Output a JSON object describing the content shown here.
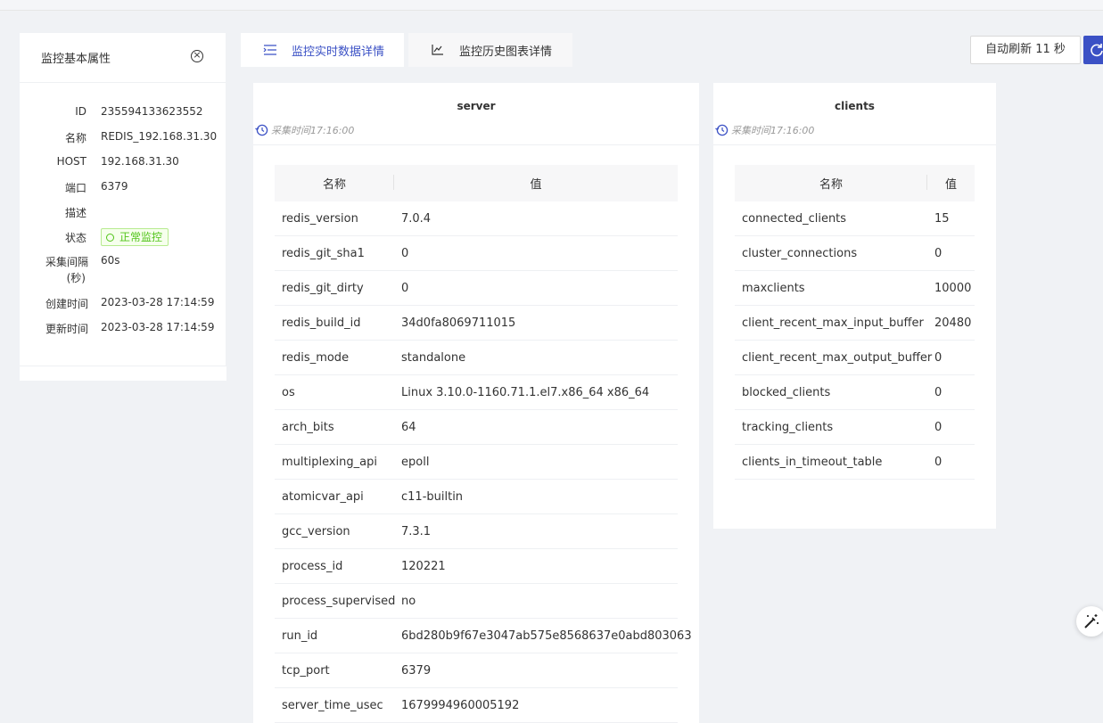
{
  "left_panel": {
    "title": "监控基本属性",
    "props": [
      {
        "label": "ID",
        "value": "235594133623552"
      },
      {
        "label": "名称",
        "value": "REDIS_192.168.31.30"
      },
      {
        "label": "HOST",
        "value": "192.168.31.30"
      },
      {
        "label": "端口",
        "value": "6379"
      },
      {
        "label": "描述",
        "value": ""
      },
      {
        "label": "状态",
        "value": "正常监控"
      },
      {
        "label": "采集间隔",
        "label2": "(秒)",
        "value": "60s"
      },
      {
        "label": "创建时间",
        "value": "2023-03-28 17:14:59"
      },
      {
        "label": "更新时间",
        "value": "2023-03-28 17:14:59"
      }
    ]
  },
  "tabs": {
    "realtime": "监控实时数据详情",
    "history": "监控历史图表详情"
  },
  "refresh": {
    "label": "自动刷新 11 秒"
  },
  "server": {
    "title": "server",
    "time": "采集时间17:16:00",
    "col_name": "名称",
    "col_value": "值",
    "rows": [
      [
        "redis_version",
        "7.0.4"
      ],
      [
        "redis_git_sha1",
        "0"
      ],
      [
        "redis_git_dirty",
        "0"
      ],
      [
        "redis_build_id",
        "34d0fa8069711015"
      ],
      [
        "redis_mode",
        "standalone"
      ],
      [
        "os",
        "Linux 3.10.0-1160.71.1.el7.x86_64 x86_64"
      ],
      [
        "arch_bits",
        "64"
      ],
      [
        "multiplexing_api",
        "epoll"
      ],
      [
        "atomicvar_api",
        "c11-builtin"
      ],
      [
        "gcc_version",
        "7.3.1"
      ],
      [
        "process_id",
        "120221"
      ],
      [
        "process_supervised",
        "no"
      ],
      [
        "run_id",
        "6bd280b9f67e3047ab575e8568637e0abd803063"
      ],
      [
        "tcp_port",
        "6379"
      ],
      [
        "server_time_usec",
        "1679994960005192"
      ]
    ]
  },
  "clients": {
    "title": "clients",
    "time": "采集时间17:16:00",
    "col_name": "名称",
    "col_value": "值",
    "rows": [
      [
        "connected_clients",
        "15"
      ],
      [
        "cluster_connections",
        "0"
      ],
      [
        "maxclients",
        "10000"
      ],
      [
        "client_recent_max_input_buffer",
        "20480"
      ],
      [
        "client_recent_max_output_buffer",
        "0"
      ],
      [
        "blocked_clients",
        "0"
      ],
      [
        "tracking_clients",
        "0"
      ],
      [
        "clients_in_timeout_table",
        "0"
      ]
    ]
  },
  "colors": {
    "accent": "#3b51c5",
    "status_green": "#52c41a",
    "page_bg": "#f0f2f5"
  },
  "icons": {
    "close": "close-circle-icon",
    "realtime_tab": "list-icon",
    "history_tab": "line-chart-icon",
    "refresh": "refresh-icon",
    "clock": "clock-icon",
    "magic": "magic-wand-icon"
  }
}
